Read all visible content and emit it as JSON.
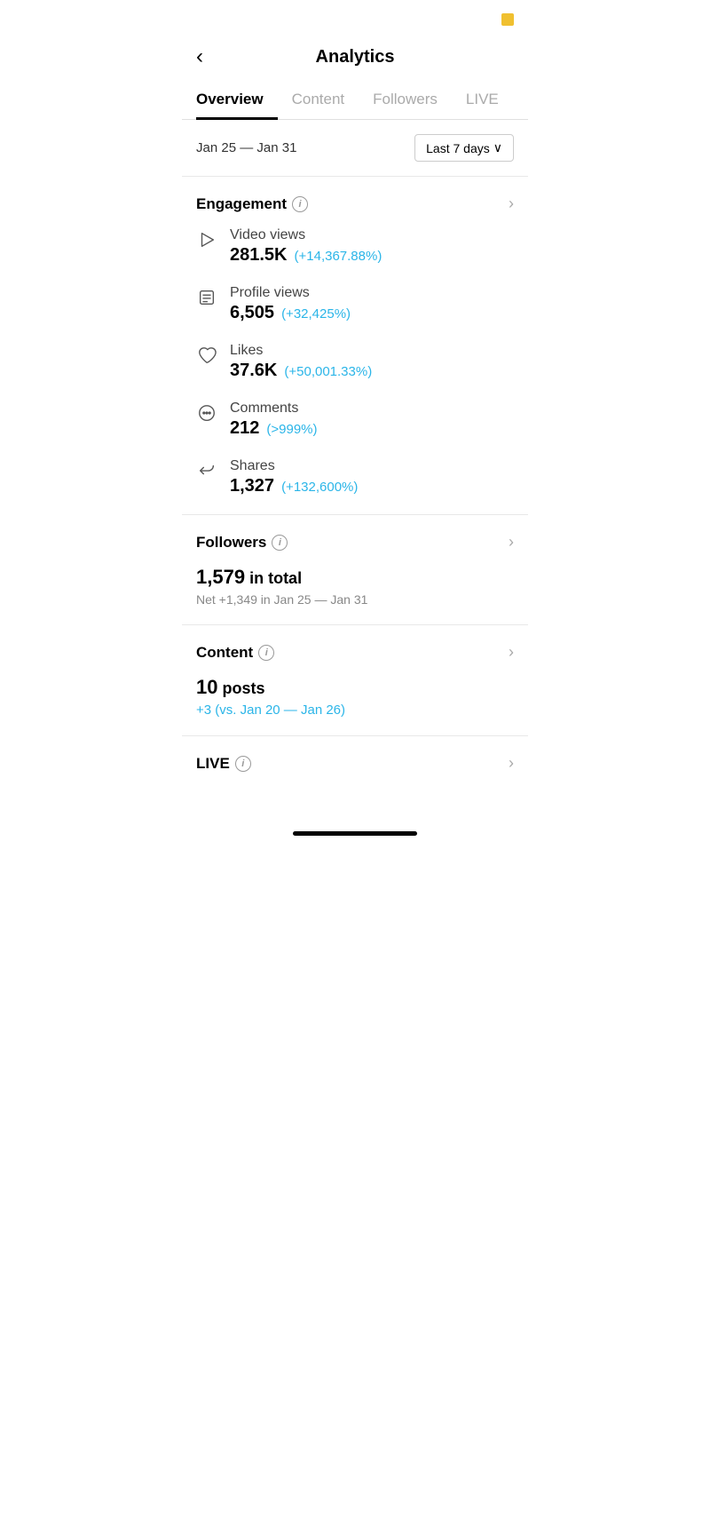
{
  "statusBar": {
    "indicator": "yellow"
  },
  "header": {
    "backLabel": "‹",
    "title": "Analytics"
  },
  "tabs": [
    {
      "label": "Overview",
      "active": true
    },
    {
      "label": "Content",
      "active": false
    },
    {
      "label": "Followers",
      "active": false
    },
    {
      "label": "LIVE",
      "active": false
    }
  ],
  "dateRange": {
    "label": "Jan 25 — Jan 31",
    "filter": "Last 7 days",
    "filterChevron": "∨"
  },
  "engagement": {
    "title": "Engagement",
    "infoLabel": "i",
    "metrics": [
      {
        "label": "Video views",
        "value": "281.5K",
        "change": "(+14,367.88%)"
      },
      {
        "label": "Profile views",
        "value": "6,505",
        "change": "(+32,425%)"
      },
      {
        "label": "Likes",
        "value": "37.6K",
        "change": "(+50,001.33%)"
      },
      {
        "label": "Comments",
        "value": "212",
        "change": "(>999%)"
      },
      {
        "label": "Shares",
        "value": "1,327",
        "change": "(+132,600%)"
      }
    ]
  },
  "followers": {
    "title": "Followers",
    "infoLabel": "i",
    "total": "1,579",
    "totalSuffix": "in total",
    "net": "Net +1,349 in Jan 25 — Jan 31"
  },
  "content": {
    "title": "Content",
    "infoLabel": "i",
    "posts": "10",
    "postsSuffix": "posts",
    "change": "+3 (vs. Jan 20 — Jan 26)"
  },
  "live": {
    "title": "LIVE",
    "infoLabel": "i"
  }
}
